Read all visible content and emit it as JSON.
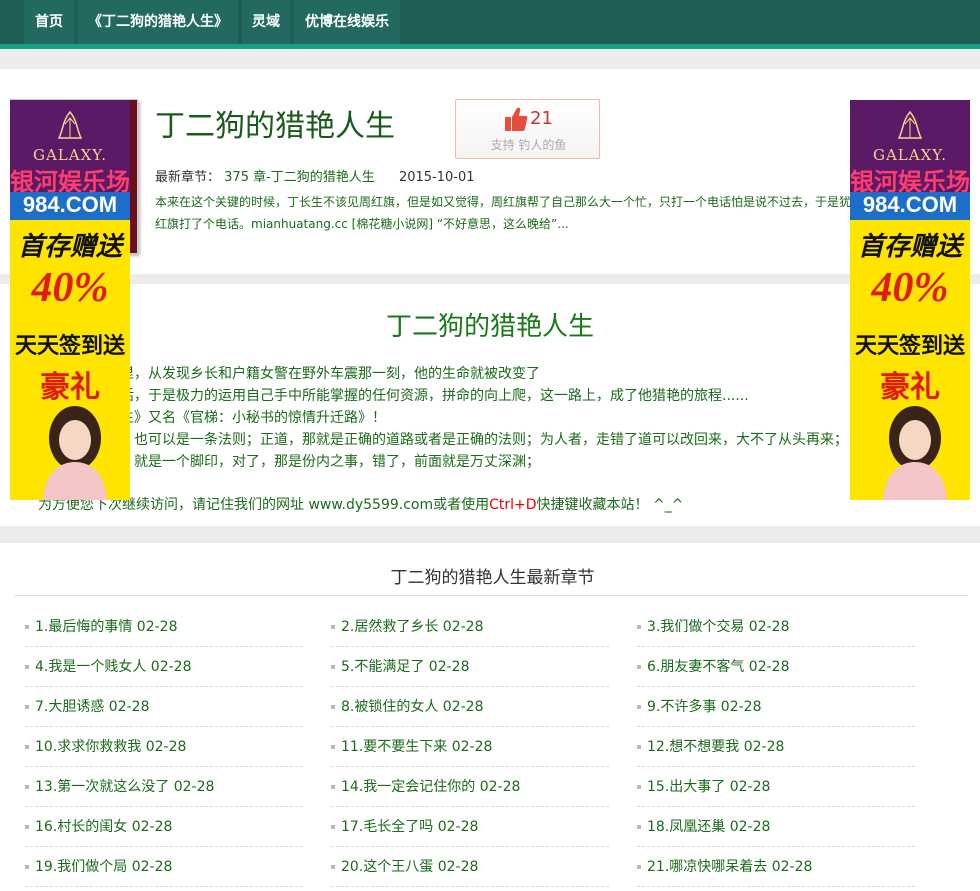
{
  "nav": {
    "items": [
      {
        "label": "首页"
      },
      {
        "label": "《丁二狗的猎艳人生》"
      },
      {
        "label": "灵域"
      },
      {
        "label": "优博在线娱乐"
      }
    ]
  },
  "book": {
    "title": "丁二狗的猎艳人生",
    "vote_count": "21",
    "vote_label": "支持 钓人的鱼",
    "latest_label": "最新章节：",
    "latest_chapter": "375 章-丁二狗的猎艳人生",
    "latest_date": "2015-10-01",
    "summary_line1": "本来在这个关键的时候，丁长生不该见周红旗，但是如又觉得，周红旗帮了自己那么大一个忙，只打一个电话怕是说不过去，于是犹",
    "summary_line2": "红旗打了个电话。mianhuatang.cc [棉花糖小说网] “不好意思，这么晚给”..."
  },
  "intro": {
    "title": "丁二狗的猎艳人生",
    "lines": [
      "里，从发现乡长和户籍女警在野外车震那一刻，他的生命就被改变了",
      "活，于是极力的运用自己手中所能掌握的任何资源，拼命的向上爬，这一路上，成了他猎艳的旅程......",
      "生》又名《官梯：小秘书的惊情升迁路》！",
      "，也可以是一条法则；正道，那就是正确的道路或者是正确的法则；为人者，走错了道可以改回来，大不了从头再来；",
      "，就是一个脚印，对了，那是份内之事，错了，前面就是万丈深渊；"
    ],
    "tip_before": "为方便您下次继续访问，请记住我们的网址 www.dy5599.com或者使用",
    "tip_hot": "Ctrl+D",
    "tip_after": "快捷键收藏本站！ ^_^"
  },
  "chapters": {
    "title": "丁二狗的猎艳人生最新章节",
    "items": [
      "1.最后悔的事情 02-28",
      "2.居然救了乡长 02-28",
      "3.我们做个交易 02-28",
      "4.我是一个贱女人 02-28",
      "5.不能满足了 02-28",
      "6.朋友妻不客气 02-28",
      "7.大胆诱惑 02-28",
      "8.被锁住的女人 02-28",
      "9.不许多事 02-28",
      "10.求求你救救我 02-28",
      "11.要不要生下来 02-28",
      "12.想不想要我 02-28",
      "13.第一次就这么没了 02-28",
      "14.我一定会记住你的 02-28",
      "15.出大事了 02-28",
      "16.村长的闺女 02-28",
      "17.毛长全了吗 02-28",
      "18.凤凰还巢 02-28",
      "19.我们做个局 02-28",
      "20.这个王八蛋 02-28",
      "21.哪凉快哪呆着去 02-28"
    ]
  },
  "ads": {
    "brand": "GALAXY.",
    "name": "银河娱乐场",
    "domain": "984.COM",
    "line1": "首存赠送",
    "percent": "40%",
    "line2": "天天签到送",
    "gift": "豪礼"
  },
  "colors": {
    "nav_bg": "#1e5e55",
    "nav_accent": "#16a085",
    "link_green": "#1a6b1a",
    "hot_red": "#e00000"
  }
}
